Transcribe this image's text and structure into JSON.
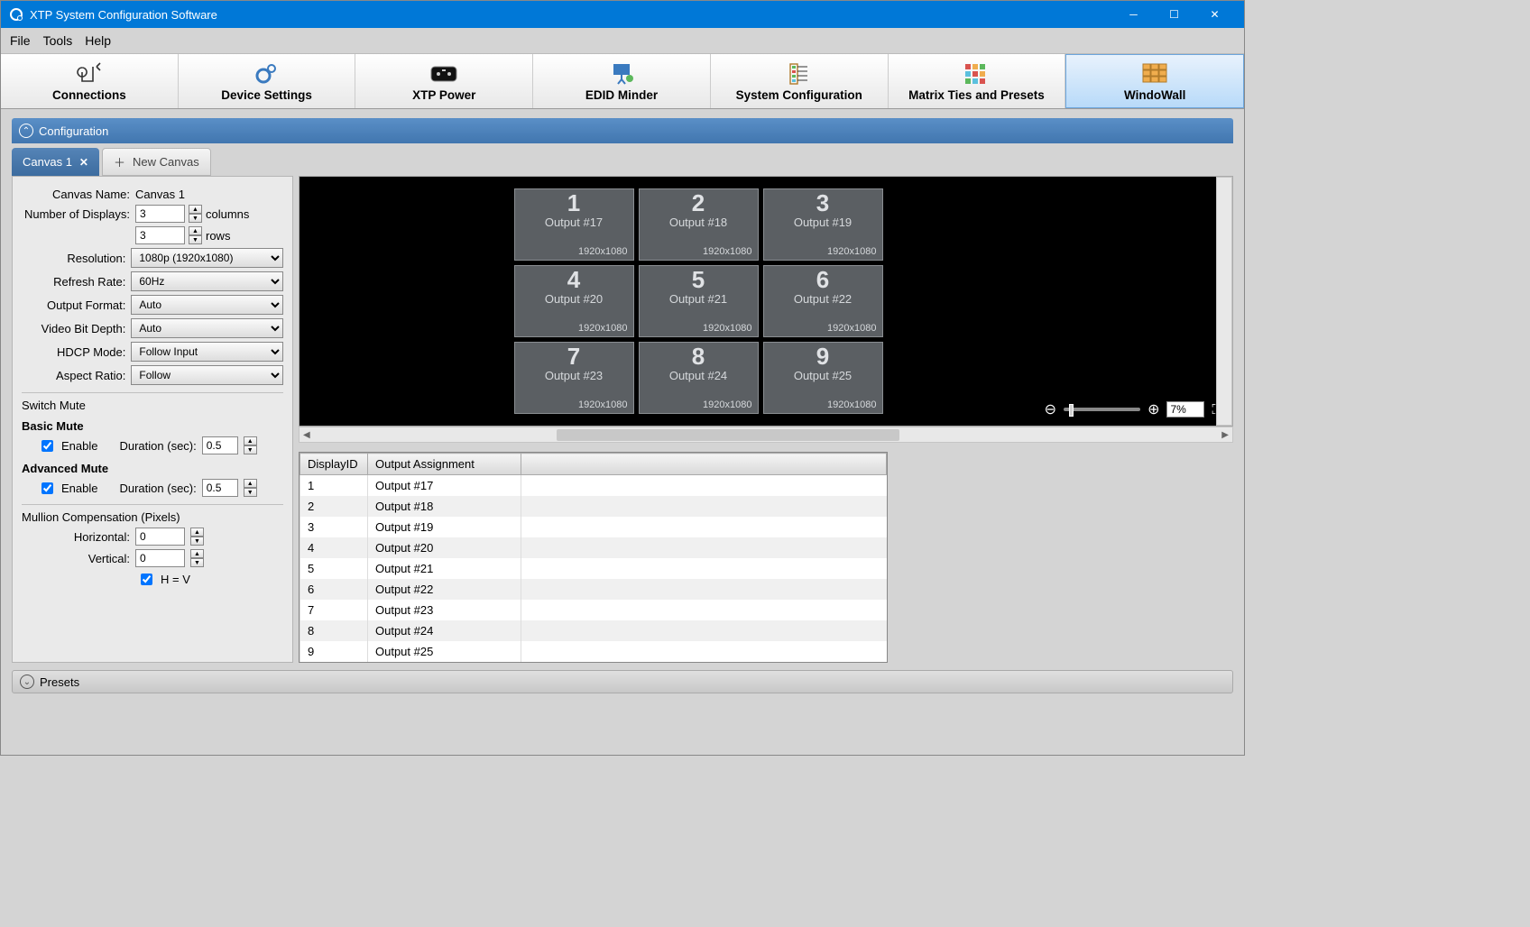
{
  "window": {
    "title": "XTP System Configuration Software"
  },
  "menu": {
    "file": "File",
    "tools": "Tools",
    "help": "Help"
  },
  "toolbar": {
    "connections": "Connections",
    "device_settings": "Device Settings",
    "xtp_power": "XTP Power",
    "edid_minder": "EDID Minder",
    "system_config": "System Configuration",
    "matrix_ties": "Matrix Ties and Presets",
    "windowall": "WindoWall"
  },
  "config": {
    "section_label": "Configuration",
    "tab_active": "Canvas 1",
    "tab_new": "New Canvas",
    "canvas_name_lbl": "Canvas Name:",
    "canvas_name_val": "Canvas 1",
    "num_displays_lbl": "Number of Displays:",
    "cols": "3",
    "cols_lbl": "columns",
    "rows": "3",
    "rows_lbl": "rows",
    "resolution_lbl": "Resolution:",
    "resolution_val": "1080p (1920x1080)",
    "refresh_lbl": "Refresh Rate:",
    "refresh_val": "60Hz",
    "format_lbl": "Output Format:",
    "format_val": "Auto",
    "depth_lbl": "Video Bit Depth:",
    "depth_val": "Auto",
    "hdcp_lbl": "HDCP Mode:",
    "hdcp_val": "Follow Input",
    "aspect_lbl": "Aspect Ratio:",
    "aspect_val": "Follow",
    "switch_mute": "Switch Mute",
    "basic_mute": "Basic Mute",
    "advanced_mute": "Advanced Mute",
    "enable": "Enable",
    "duration_lbl": "Duration (sec):",
    "basic_dur": "0.5",
    "adv_dur": "0.5",
    "mullion": "Mullion Compensation (Pixels)",
    "horiz_lbl": "Horizontal:",
    "horiz_val": "0",
    "vert_lbl": "Vertical:",
    "vert_val": "0",
    "hv": "H = V"
  },
  "grid": [
    {
      "n": "1",
      "o": "Output #17",
      "r": "1920x1080"
    },
    {
      "n": "2",
      "o": "Output #18",
      "r": "1920x1080"
    },
    {
      "n": "3",
      "o": "Output #19",
      "r": "1920x1080"
    },
    {
      "n": "4",
      "o": "Output #20",
      "r": "1920x1080"
    },
    {
      "n": "5",
      "o": "Output #21",
      "r": "1920x1080"
    },
    {
      "n": "6",
      "o": "Output #22",
      "r": "1920x1080"
    },
    {
      "n": "7",
      "o": "Output #23",
      "r": "1920x1080"
    },
    {
      "n": "8",
      "o": "Output #24",
      "r": "1920x1080"
    },
    {
      "n": "9",
      "o": "Output #25",
      "r": "1920x1080"
    }
  ],
  "zoom": {
    "value": "7%"
  },
  "table": {
    "h1": "DisplayID",
    "h2": "Output Assignment",
    "rows": [
      {
        "id": "1",
        "out": "Output #17"
      },
      {
        "id": "2",
        "out": "Output #18"
      },
      {
        "id": "3",
        "out": "Output #19"
      },
      {
        "id": "4",
        "out": "Output #20"
      },
      {
        "id": "5",
        "out": "Output #21"
      },
      {
        "id": "6",
        "out": "Output #22"
      },
      {
        "id": "7",
        "out": "Output #23"
      },
      {
        "id": "8",
        "out": "Output #24"
      },
      {
        "id": "9",
        "out": "Output #25"
      }
    ]
  },
  "presets": {
    "label": "Presets"
  }
}
